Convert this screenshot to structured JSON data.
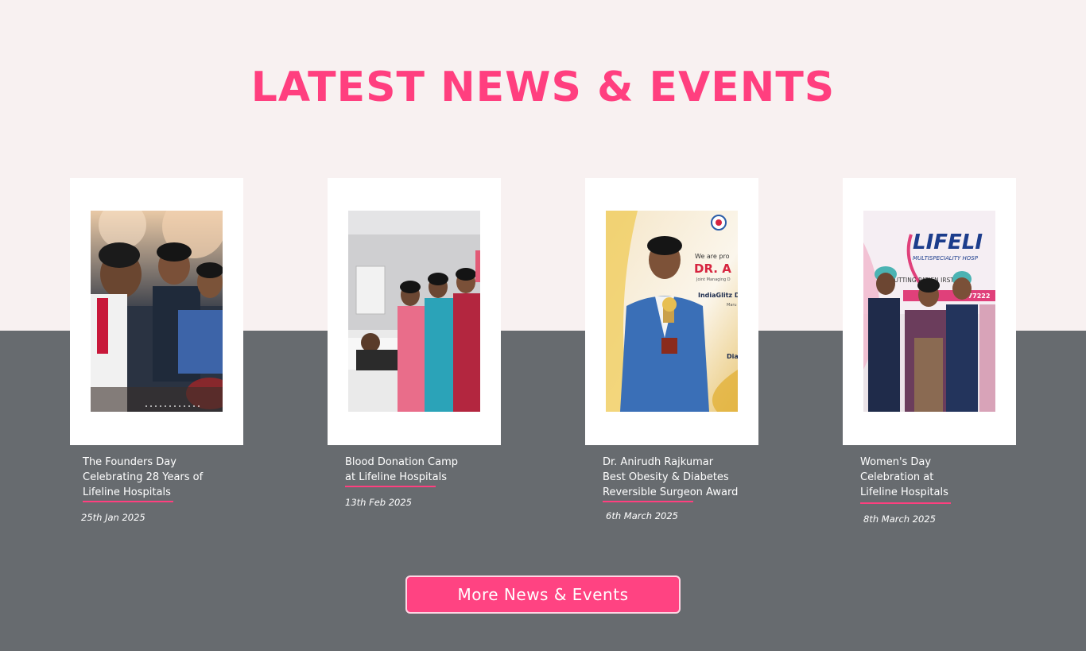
{
  "section": {
    "title": "LATEST NEWS & EVENTS"
  },
  "colors": {
    "accent": "#ff3f7f",
    "top_background": "#f8f1f1",
    "bottom_background": "#676b6f",
    "card": "#ffffff"
  },
  "news": [
    {
      "title_lines": [
        "The Founders Day",
        "Celebrating 28 Years of",
        "Lifeline Hospitals"
      ],
      "date": "25th Jan 2025",
      "image_icon": "founders-day-photo"
    },
    {
      "title_lines": [
        "Blood Donation Camp",
        "at Lifeline Hospitals"
      ],
      "date": "13th Feb 2025",
      "image_icon": "blood-donation-photo"
    },
    {
      "title_lines": [
        "Dr. Anirudh Rajkumar",
        "Best Obesity & Diabetes",
        "Reversible Surgeon Award"
      ],
      "date": "6th March 2025",
      "image_icon": "award-photo",
      "poster_text": {
        "line1": "We are pro",
        "line2": "DR. A",
        "line3": "Joint Managing D",
        "line4": "IndiaGlitz D",
        "line5": "Maru",
        "line6": "Dia"
      }
    },
    {
      "title_lines": [
        "Women's Day",
        "Celebration at",
        "Lifeline Hospitals"
      ],
      "date": "8th March 2025",
      "image_icon": "womens-day-photo",
      "banner_text": {
        "brand": "LIFELI",
        "sub": "MULTISPECIALITY HOSP",
        "tagline": "PUTTING PATIEN    IRST SIN",
        "phone": "577222"
      }
    }
  ],
  "cta": {
    "label": "More News & Events"
  }
}
